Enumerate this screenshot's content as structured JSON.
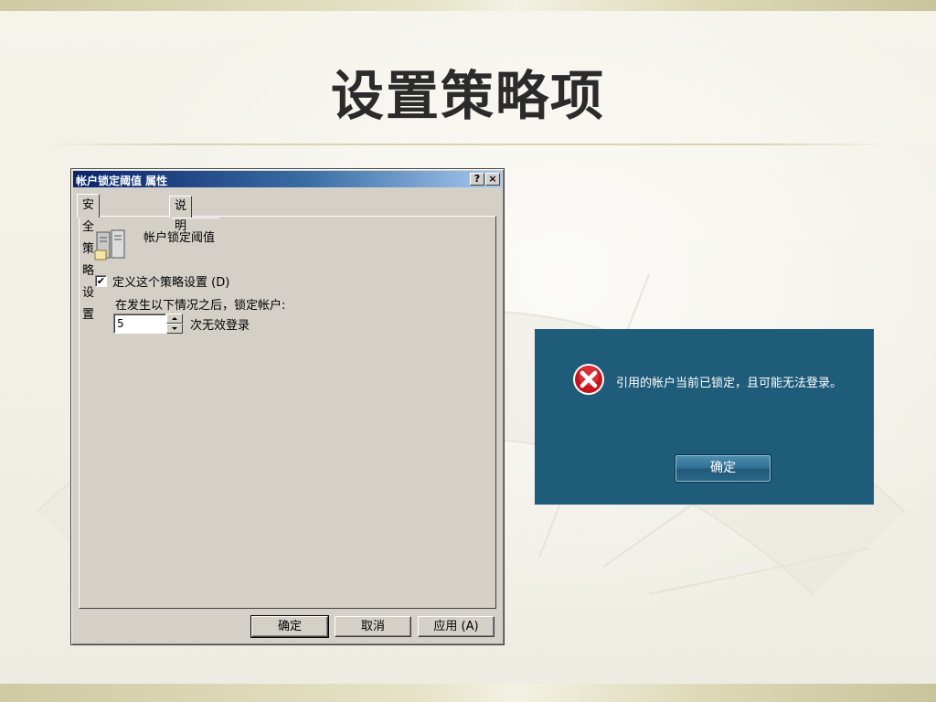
{
  "slide": {
    "title": "设置策略项"
  },
  "dialog": {
    "title": "帐户锁定阈值 属性",
    "help_button": "?",
    "close_button": "×",
    "tabs": [
      {
        "label": "安全策略设置",
        "active": true
      },
      {
        "label": "说明",
        "active": false
      }
    ],
    "policy_name": "帐户锁定阈值",
    "define_checkbox": {
      "label": "定义这个策略设置 (D)",
      "checked": true,
      "mark": "✔"
    },
    "lockout_text": "在发生以下情况之后，锁定帐户:",
    "threshold_value": "5",
    "attempts_label": "次无效登录",
    "buttons": {
      "ok": "确定",
      "cancel": "取消",
      "apply": "应用 (A)"
    }
  },
  "lockout_message": {
    "text": "引用的帐户当前已锁定，且可能无法登录。",
    "ok_button": "确定",
    "icon": "error-icon",
    "background_color": "#1f5c7a"
  }
}
